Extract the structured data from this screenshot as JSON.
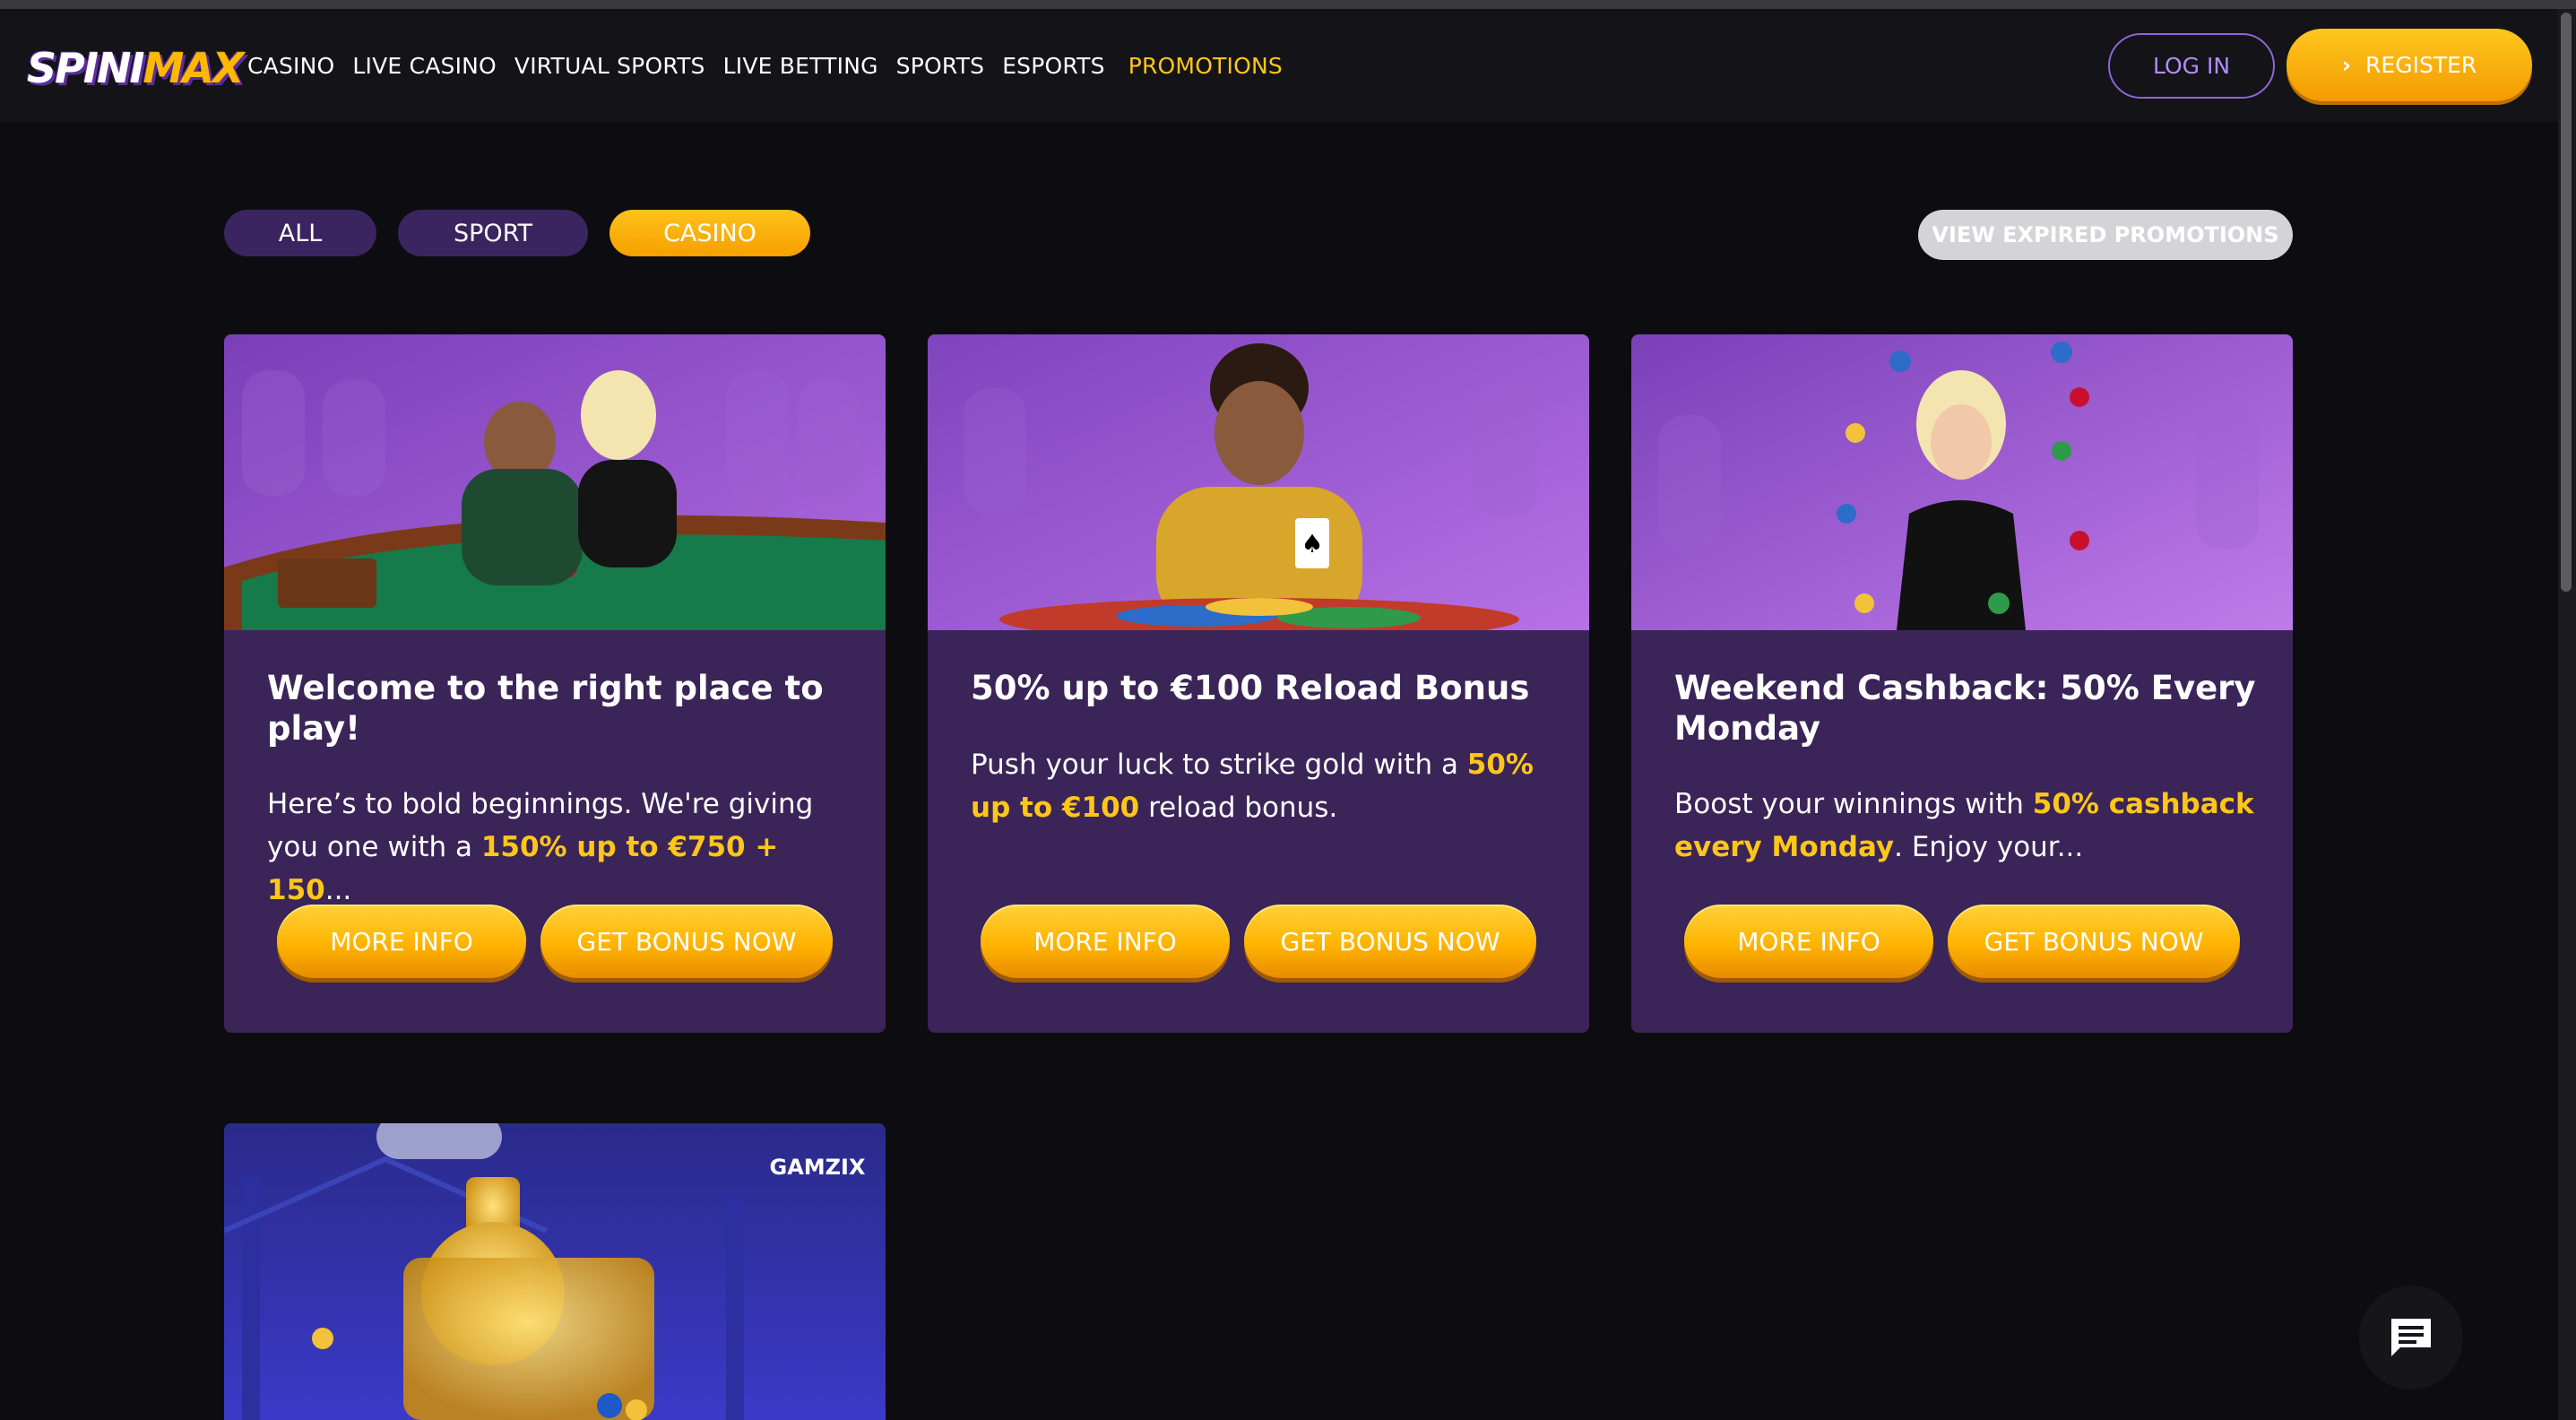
{
  "logo": {
    "part_a": "SPINI",
    "part_b": "MAX"
  },
  "nav": {
    "items": [
      "CASINO",
      "LIVE CASINO",
      "VIRTUAL SPORTS",
      "LIVE BETTING",
      "SPORTS",
      "ESPORTS"
    ],
    "promotions": "PROMOTIONS"
  },
  "header": {
    "login": "LOG IN",
    "register": "REGISTER"
  },
  "filters": {
    "all": "ALL",
    "sport": "SPORT",
    "casino": "CASINO",
    "active": "CASINO",
    "expired": "VIEW EXPIRED PROMOTIONS"
  },
  "cards": [
    {
      "title": "Welcome to the right place to play!",
      "desc_before": "Here’s to bold beginnings. We're giving you one with a ",
      "desc_highlight": "150% up to €750 + 150",
      "desc_after": "...",
      "more": "MORE INFO",
      "get": "GET BONUS NOW"
    },
    {
      "title": "50% up to €100 Reload Bonus",
      "desc_before": "Push your luck to strike gold with a ",
      "desc_highlight": "50% up to €100",
      "desc_after": " reload bonus.",
      "more": "MORE INFO",
      "get": "GET BONUS NOW"
    },
    {
      "title": "Weekend Cashback: 50% Every Monday",
      "desc_before": "Boost your winnings with ",
      "desc_highlight": "50% cashback every Monday",
      "desc_after": ". Enjoy your...",
      "more": "MORE INFO",
      "get": "GET BONUS NOW"
    }
  ],
  "card4": {
    "provider": "GAMZIX"
  },
  "colors": {
    "accent": "#ffc61a",
    "card_bg": "#3a2458",
    "page_bg": "#0d0c10",
    "chip_bg": "#3a2560"
  },
  "icons": {
    "chat": "chat-bubble-icon",
    "register_chevron": "chevron-right-icon"
  }
}
